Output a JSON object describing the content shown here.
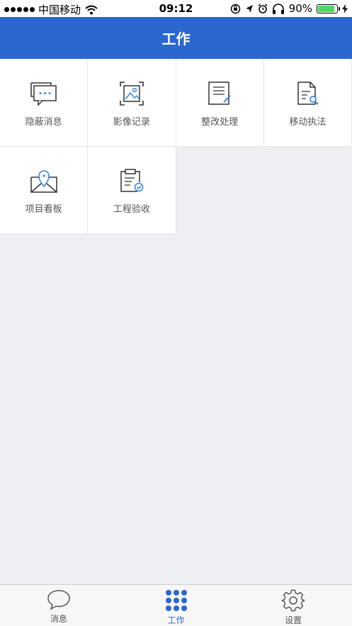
{
  "status": {
    "carrier": "中国移动",
    "time": "09:12",
    "battery": "90%",
    "battery_level": 0.9
  },
  "header": {
    "title": "工作"
  },
  "grid": {
    "items": [
      {
        "label": "隐蔽消息",
        "icon": "chat-dots-icon"
      },
      {
        "label": "影像记录",
        "icon": "image-frame-icon"
      },
      {
        "label": "整改处理",
        "icon": "edit-document-icon"
      },
      {
        "label": "移动执法",
        "icon": "document-search-icon"
      },
      {
        "label": "项目看板",
        "icon": "map-pin-icon"
      },
      {
        "label": "工程验收",
        "icon": "clipboard-check-icon"
      }
    ]
  },
  "tabbar": {
    "tabs": [
      {
        "label": "消息",
        "icon": "chat-bubble-icon"
      },
      {
        "label": "工作",
        "icon": "grid-dots-icon"
      },
      {
        "label": "设置",
        "icon": "gear-icon"
      }
    ]
  },
  "colors": {
    "primary": "#2a67cf",
    "icon_accent": "#3a86e6",
    "icon_stroke": "#333333"
  }
}
